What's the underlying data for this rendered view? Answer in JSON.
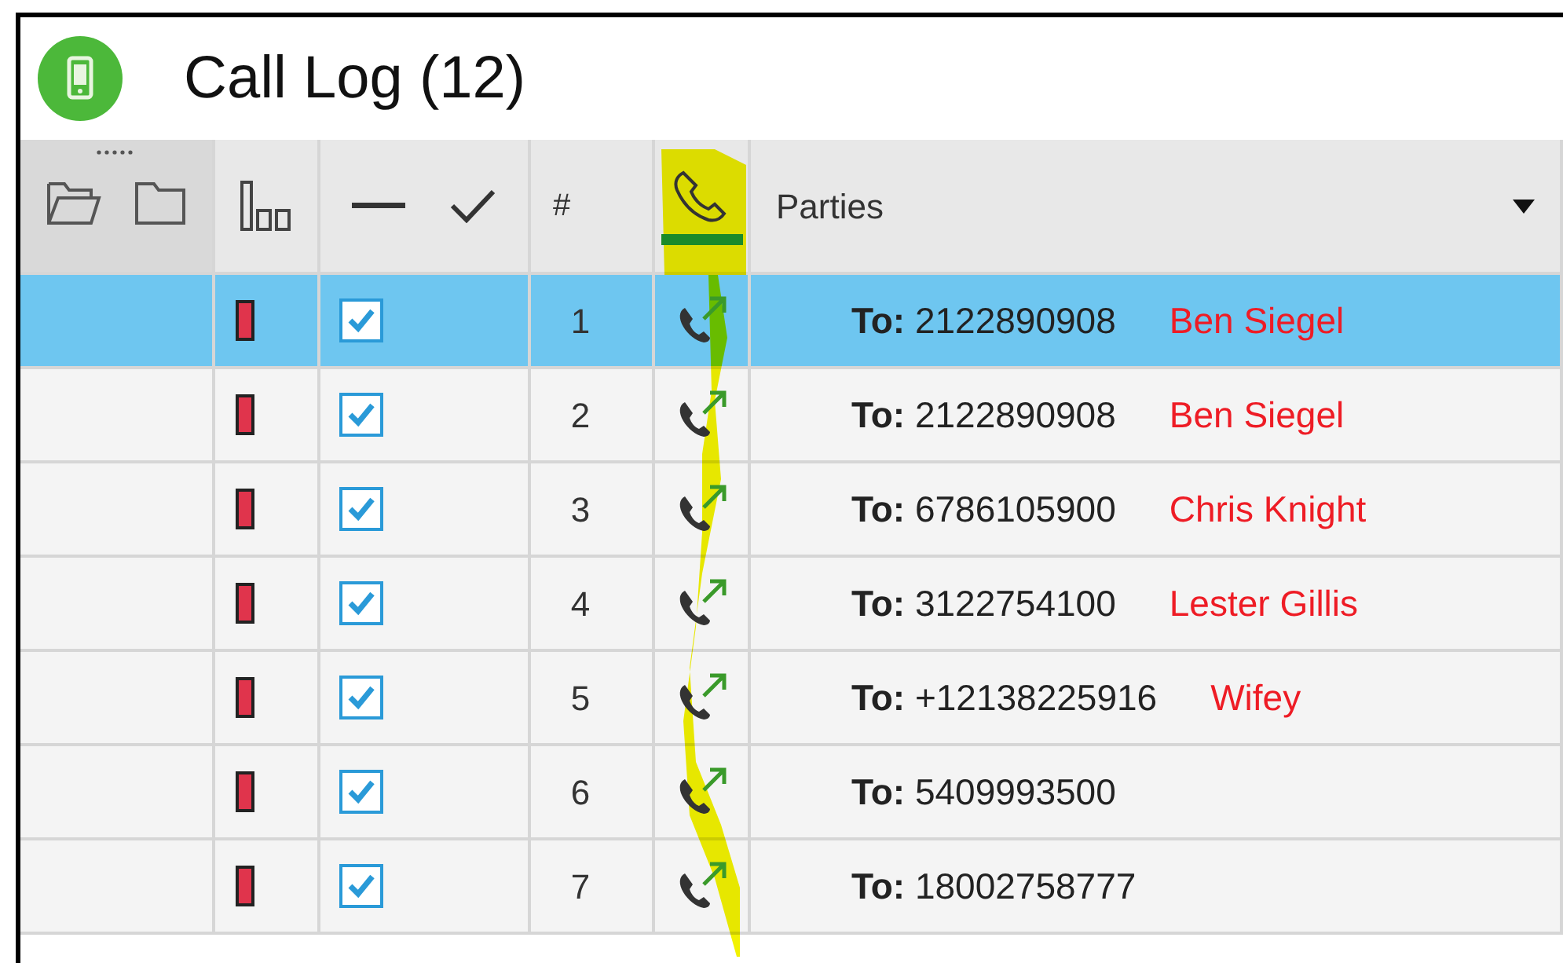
{
  "window": {
    "title": "Call Log (12)"
  },
  "header": {
    "number": "#",
    "parties": "Parties"
  },
  "rows": [
    {
      "number": "1",
      "prefix": "To:",
      "phone": "2122890908",
      "name": "Ben Siegel",
      "checked": true,
      "selected": true
    },
    {
      "number": "2",
      "prefix": "To:",
      "phone": "2122890908",
      "name": "Ben Siegel",
      "checked": true,
      "selected": false
    },
    {
      "number": "3",
      "prefix": "To:",
      "phone": "6786105900",
      "name": "Chris Knight",
      "checked": true,
      "selected": false
    },
    {
      "number": "4",
      "prefix": "To:",
      "phone": "3122754100",
      "name": "Lester Gillis",
      "checked": true,
      "selected": false
    },
    {
      "number": "5",
      "prefix": "To:",
      "phone": "+12138225916",
      "name": "Wifey",
      "checked": true,
      "selected": false
    },
    {
      "number": "6",
      "prefix": "To:",
      "phone": "5409993500",
      "checked": true,
      "selected": false
    },
    {
      "number": "7",
      "prefix": "To:",
      "phone": "18002758777",
      "checked": true,
      "selected": false
    }
  ]
}
